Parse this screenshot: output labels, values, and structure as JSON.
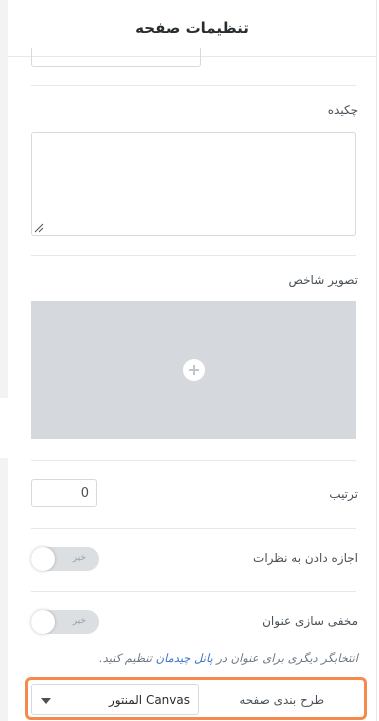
{
  "header": {
    "title": "تنظیمات صفحه"
  },
  "excerpt": {
    "label": "چکیده",
    "value": ""
  },
  "featured_image": {
    "label": "تصویر شاخص",
    "add_icon": "plus-circle-icon"
  },
  "order": {
    "label": "ترتیب",
    "value": "0"
  },
  "allow_comments": {
    "label": "اجازه دادن به نظرات",
    "state_text": "خیر",
    "enabled": false
  },
  "hide_title": {
    "label": "مخفی سازی عنوان",
    "state_text": "خیر",
    "enabled": false,
    "description_prefix": "انتخابگر دیگری برای عنوان در ",
    "description_link": "پانل چیدمان",
    "description_suffix": " تنظیم کنید."
  },
  "page_layout": {
    "label": "طرح بندی صفحه",
    "selected": "Canvas المنتور"
  },
  "colors": {
    "highlight": "#f58a4b",
    "link": "#3d74c8",
    "toggle_off": "#dcdfe2",
    "image_placeholder": "#d5d8dc"
  }
}
